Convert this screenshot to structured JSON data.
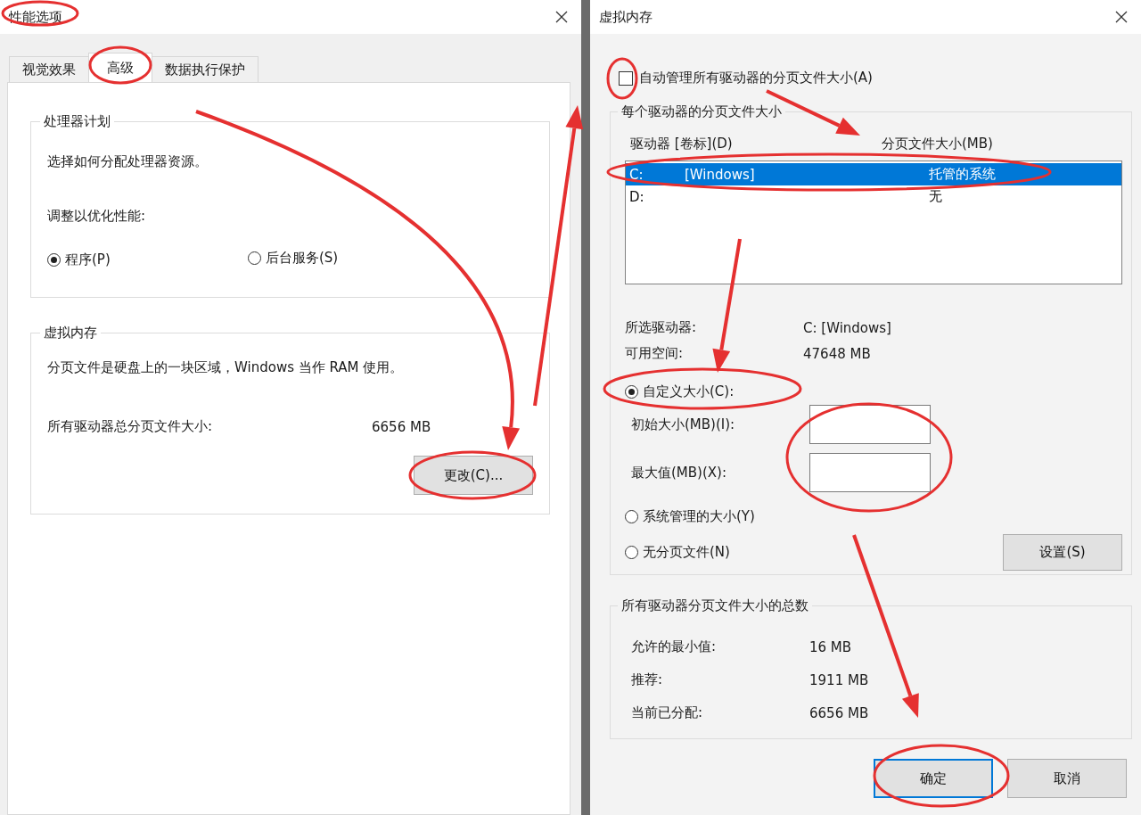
{
  "left_dialog": {
    "title": "性能选项",
    "tabs": [
      {
        "label": "视觉效果",
        "selected": false
      },
      {
        "label": "高级",
        "selected": true
      },
      {
        "label": "数据执行保护",
        "selected": false
      }
    ],
    "processor_group": {
      "title": "处理器计划",
      "description": "选择如何分配处理器资源。",
      "adjust_label": "调整以优化性能:",
      "options": [
        {
          "label": "程序(P)",
          "selected": true
        },
        {
          "label": "后台服务(S)",
          "selected": false
        }
      ]
    },
    "vm_group": {
      "title": "虚拟内存",
      "description": "分页文件是硬盘上的一块区域，Windows 当作 RAM 使用。",
      "total_label": "所有驱动器总分页文件大小:",
      "total_value": "6656 MB",
      "button": "更改(C)..."
    }
  },
  "right_dialog": {
    "title": "虚拟内存",
    "auto_manage": {
      "label": "自动管理所有驱动器的分页文件大小(A)",
      "checked": false
    },
    "drives_group": {
      "title": "每个驱动器的分页文件大小",
      "columns": [
        "驱动器 [卷标](D)",
        "分页文件大小(MB)"
      ],
      "drives": [
        {
          "drive": "C:",
          "volume": "[Windows]",
          "size": "托管的系统",
          "selected": true
        },
        {
          "drive": "D:",
          "size": "无",
          "selected": false
        }
      ],
      "info": [
        {
          "label": "所选驱动器:",
          "value": "C:  [Windows]"
        },
        {
          "label": "可用空间:",
          "value": "47648 MB"
        }
      ],
      "size_options": [
        {
          "label": "自定义大小(C):",
          "selected": true
        },
        {
          "label": "系统管理的大小(Y)",
          "selected": false
        },
        {
          "label": "无分页文件(N)",
          "selected": false
        }
      ],
      "fields": [
        {
          "label": "初始大小(MB)(I):"
        },
        {
          "label": "最大值(MB)(X):"
        }
      ],
      "set_button": "设置(S)"
    },
    "totals_group": {
      "title": "所有驱动器分页文件大小的总数",
      "rows": [
        {
          "label": "允许的最小值:",
          "value": "16 MB"
        },
        {
          "label": "推荐:",
          "value": "1911 MB"
        },
        {
          "label": "当前已分配:",
          "value": "6656 MB"
        }
      ]
    },
    "buttons": [
      {
        "label": "确定",
        "default": true
      },
      {
        "label": "取消",
        "default": false
      }
    ]
  }
}
